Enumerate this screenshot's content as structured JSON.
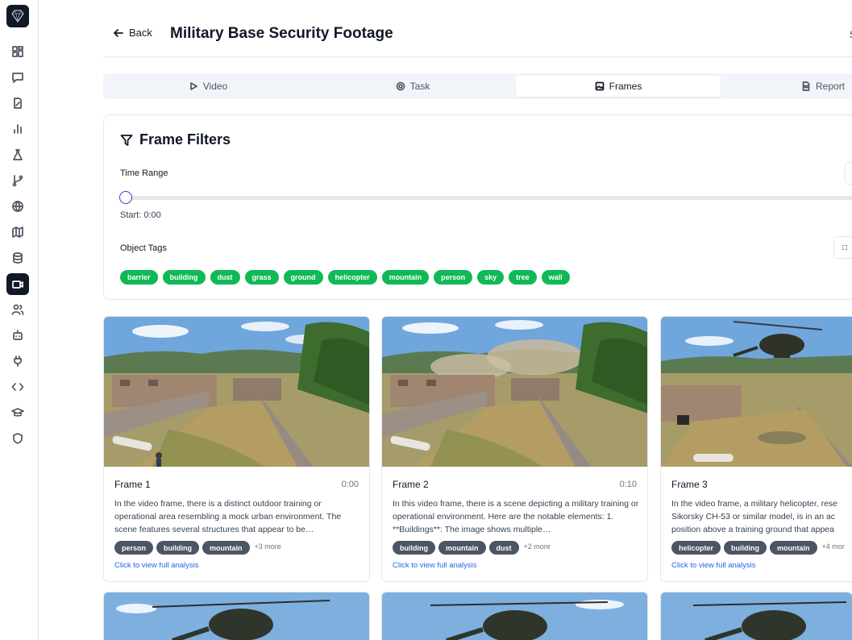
{
  "header": {
    "back_label": "Back",
    "title": "Military Base Security Footage",
    "extra": "S"
  },
  "tabs": [
    {
      "label": "Video",
      "icon": "play-icon",
      "active": false
    },
    {
      "label": "Task",
      "icon": "settings-icon",
      "active": false
    },
    {
      "label": "Frames",
      "icon": "image-icon",
      "active": true
    },
    {
      "label": "Report",
      "icon": "document-icon",
      "active": false
    }
  ],
  "filters": {
    "title": "Frame Filters",
    "time_range_label": "Time Range",
    "start_label": "Start: 0:00",
    "slider_value": 0,
    "object_tags_label": "Object Tags",
    "side_box_glyph": "□",
    "tags": [
      "barrier",
      "building",
      "dust",
      "grass",
      "ground",
      "helicopter",
      "mountain",
      "person",
      "sky",
      "tree",
      "wall"
    ]
  },
  "frames": [
    {
      "name": "Frame 1",
      "time": "0:00",
      "description": "In the video frame, there is a distinct outdoor training or operational area resembling a mock urban environment. The scene features several structures that appear to be…",
      "tags": [
        "person",
        "building",
        "mountain"
      ],
      "more": "+3 more",
      "link": "Click to view full analysis"
    },
    {
      "name": "Frame 2",
      "time": "0:10",
      "description": "In this video frame, there is a scene depicting a military training or operational environment. Here are the notable elements: 1. **Buildings**: The image shows multiple…",
      "tags": [
        "building",
        "mountain",
        "dust"
      ],
      "more": "+2 more",
      "link": "Click to view full analysis"
    },
    {
      "name": "Frame 3",
      "time": "",
      "description": "In the video frame, a military helicopter, rese Sikorsky CH-53 or similar model, is in an ac position above a training ground that appea",
      "tags": [
        "helicopter",
        "building",
        "mountain"
      ],
      "more": "+4 mor",
      "link": "Click to view full analysis"
    }
  ],
  "colors": {
    "tag_green": "#10b956",
    "chip_gray": "#4b5563",
    "link_blue": "#2563eb",
    "active_nav": "#111827"
  },
  "sidebar": {
    "items": [
      "dashboard-icon",
      "chat-icon",
      "edit-file-icon",
      "bar-chart-icon",
      "flask-icon",
      "git-branch-icon",
      "globe-icon",
      "map-icon",
      "database-icon",
      "video-icon",
      "users-icon",
      "bot-icon",
      "plug-icon",
      "code-icon",
      "graduation-cap-icon",
      "shield-icon"
    ],
    "active": "video-icon"
  }
}
